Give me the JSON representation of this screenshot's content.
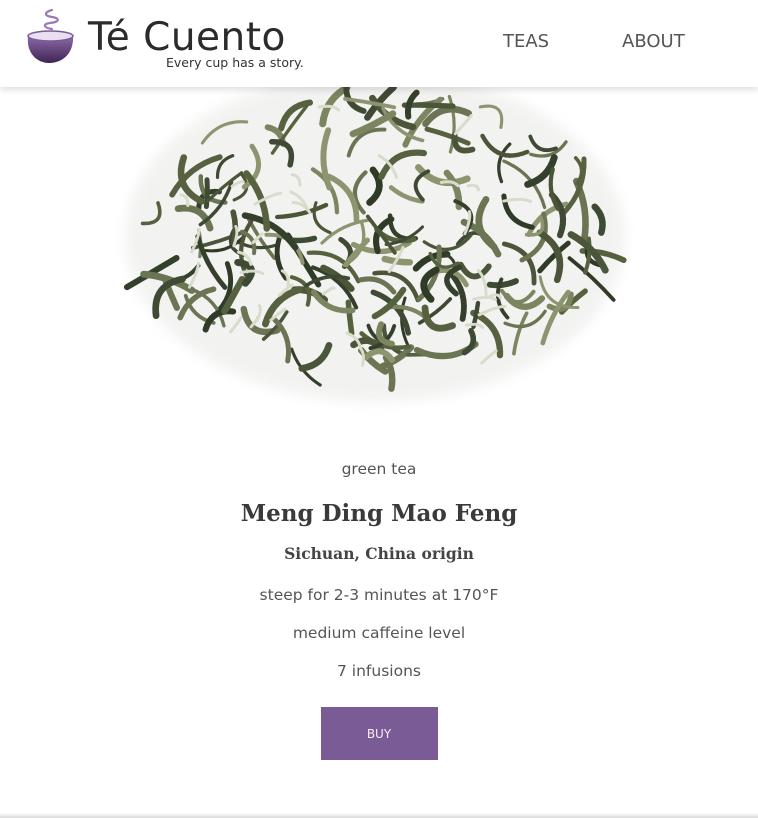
{
  "header": {
    "brand_name": "Té Cuento",
    "tagline": "Every cup has a story.",
    "logo_icon": "steaming-cup-icon",
    "nav": [
      {
        "label": "TEAS"
      },
      {
        "label": "ABOUT"
      }
    ]
  },
  "hero": {
    "image": "loose-green-tea-leaves"
  },
  "product": {
    "category": "green tea",
    "name": "Meng Ding Mao Feng",
    "origin": "Sichuan, China origin",
    "steep": "steep for 2-3 minutes at 170°F",
    "caffeine": "medium caffeine level",
    "infusions": "7 infusions",
    "buy_label": "BUY"
  },
  "colors": {
    "accent": "#7a5b96",
    "text": "#444444",
    "background": "#ffffff"
  }
}
